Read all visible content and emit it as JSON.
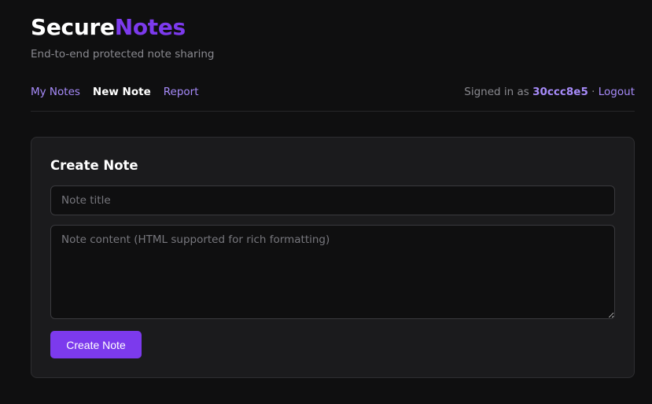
{
  "brand": {
    "part1": "Secure",
    "part2": "Notes",
    "tagline": "End-to-end protected note sharing"
  },
  "nav": {
    "my_notes": "My Notes",
    "new_note": "New Note",
    "report": "Report"
  },
  "session": {
    "signed_in_label": "Signed in as",
    "username": "30ccc8e5",
    "separator": "·",
    "logout": "Logout"
  },
  "form": {
    "heading": "Create Note",
    "title_placeholder": "Note title",
    "content_placeholder": "Note content (HTML supported for rich formatting)",
    "submit_label": "Create Note"
  },
  "colors": {
    "accent": "#7c3aed",
    "link": "#a78bfa",
    "background": "#0f0f10",
    "card": "#1b1b1d"
  }
}
